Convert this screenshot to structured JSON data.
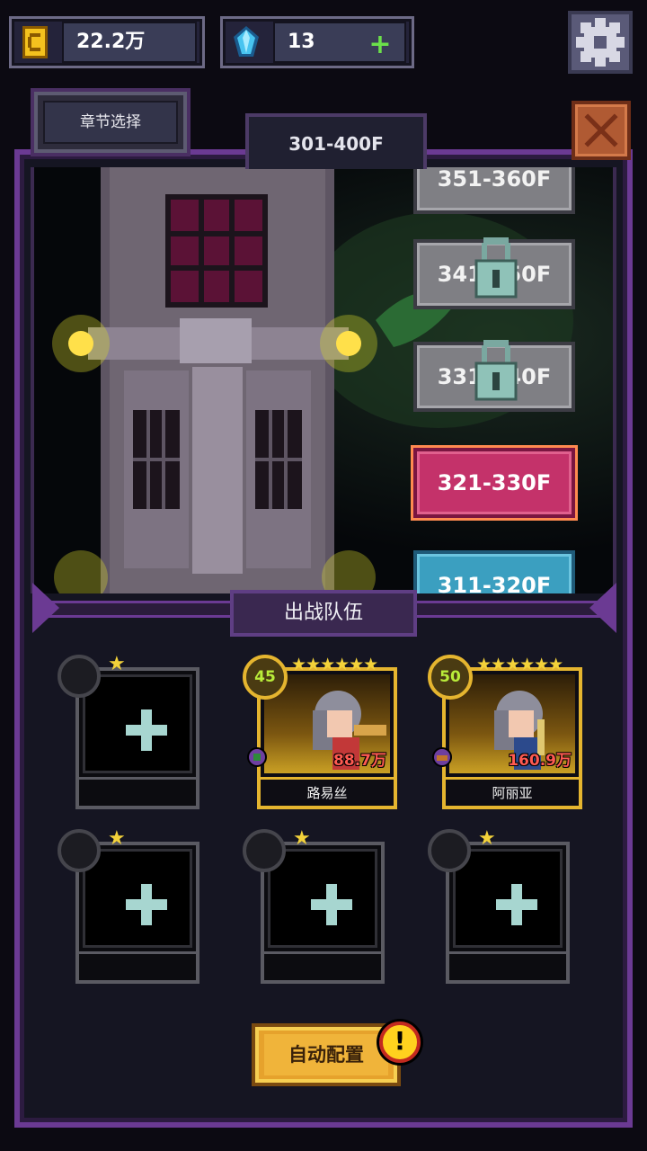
{
  "resources": {
    "gold": {
      "value": "22.2万",
      "icon": "gold-coin-icon"
    },
    "gems": {
      "value": "13",
      "icon": "blue-gem-icon",
      "add_label": "+"
    }
  },
  "header": {
    "chapter_select_label": "章节选择",
    "floor_range": "301-400F"
  },
  "floors": [
    {
      "label": "351-360F",
      "state": "locked"
    },
    {
      "label": "341-350F",
      "state": "locked"
    },
    {
      "label": "331-340F",
      "state": "locked"
    },
    {
      "label": "321-330F",
      "state": "current"
    },
    {
      "label": "311-320F",
      "state": "cleared"
    }
  ],
  "team": {
    "title": "出战队伍",
    "heroes": [
      {
        "name": "路易丝",
        "level": "45",
        "stars": "★★★★★★",
        "power": "88.7万"
      },
      {
        "name": "阿丽亚",
        "level": "50",
        "stars": "★★★★★★",
        "power": "160.9万"
      }
    ],
    "empty_slot_star": "★"
  },
  "auto_config_label": "自动配置",
  "alert_symbol": "!",
  "colors": {
    "frame_purple": "#6b3a93",
    "current_floor": "#c4326a",
    "cleared_floor": "#3b9fc0",
    "gold_accent": "#e5b52f"
  }
}
